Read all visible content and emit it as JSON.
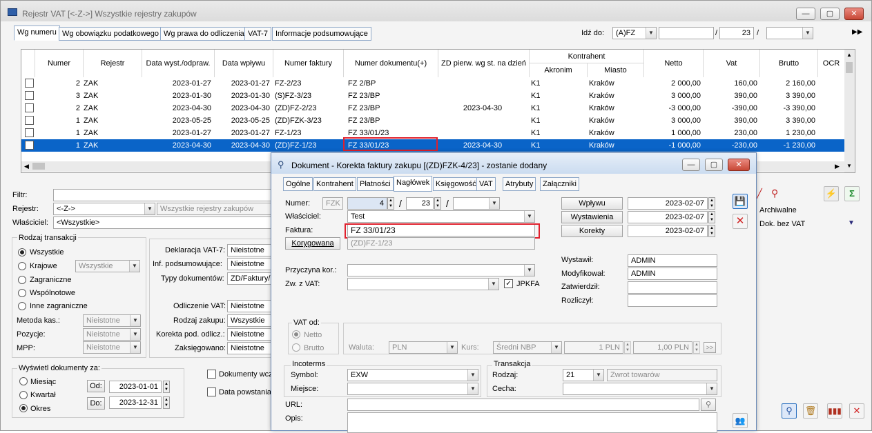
{
  "main_window": {
    "title": "Rejestr VAT   [<-Z->]   Wszystkie rejestry zakupów",
    "controls": {
      "minimize": "—",
      "maximize": "▢",
      "close": "✕"
    }
  },
  "tabs": [
    "Wg numeru",
    "Wg obowiązku podatkowego",
    "Wg prawa do odliczenia",
    "VAT-7",
    "Informacje podsumowujące"
  ],
  "goto": {
    "label": "Idź do:",
    "value": "(A)FZ",
    "number": "23",
    "sep": "/"
  },
  "table": {
    "headers": {
      "numer": "Numer",
      "rejestr": "Rejestr",
      "data_wyst": "Data wyst./odpraw.",
      "data_wplywu": "Data wpływu",
      "numer_faktury": "Numer faktury",
      "numer_dokumentu": "Numer dokumentu(+)",
      "zd": "ZD pierw. wg st. na dzień",
      "kontrahent": "Kontrahent",
      "akronim": "Akronim",
      "miasto": "Miasto",
      "netto": "Netto",
      "vat": "Vat",
      "brutto": "Brutto",
      "ocr": "OCR"
    },
    "rows": [
      {
        "numer": "2",
        "rejestr": "ZAK",
        "data_wyst": "2023-01-27",
        "data_wplywu": "2023-01-27",
        "numer_faktury": "FZ-2/23",
        "numer_dokumentu": "FZ 2/BP",
        "zd": "",
        "akronim": "K1",
        "miasto": "Kraków",
        "netto": "2 000,00",
        "vat": "160,00",
        "brutto": "2 160,00"
      },
      {
        "numer": "3",
        "rejestr": "ZAK",
        "data_wyst": "2023-01-30",
        "data_wplywu": "2023-01-30",
        "numer_faktury": "(S)FZ-3/23",
        "numer_dokumentu": "FZ 23/BP",
        "zd": "",
        "akronim": "K1",
        "miasto": "Kraków",
        "netto": "3 000,00",
        "vat": "390,00",
        "brutto": "3 390,00"
      },
      {
        "numer": "2",
        "rejestr": "ZAK",
        "data_wyst": "2023-04-30",
        "data_wplywu": "2023-04-30",
        "numer_faktury": "(ZD)FZ-2/23",
        "numer_dokumentu": "FZ 23/BP",
        "zd": "2023-04-30",
        "akronim": "K1",
        "miasto": "Kraków",
        "netto": "-3 000,00",
        "vat": "-390,00",
        "brutto": "-3 390,00"
      },
      {
        "numer": "1",
        "rejestr": "ZAK",
        "data_wyst": "2023-05-25",
        "data_wplywu": "2023-05-25",
        "numer_faktury": "(ZD)FZK-3/23",
        "numer_dokumentu": "FZ 23/BP",
        "zd": "",
        "akronim": "K1",
        "miasto": "Kraków",
        "netto": "3 000,00",
        "vat": "390,00",
        "brutto": "3 390,00"
      },
      {
        "numer": "1",
        "rejestr": "ZAK",
        "data_wyst": "2023-01-27",
        "data_wplywu": "2023-01-27",
        "numer_faktury": "FZ-1/23",
        "numer_dokumentu": "FZ 33/01/23",
        "zd": "",
        "akronim": "K1",
        "miasto": "Kraków",
        "netto": "1 000,00",
        "vat": "230,00",
        "brutto": "1 230,00"
      },
      {
        "numer": "1",
        "rejestr": "ZAK",
        "data_wyst": "2023-04-30",
        "data_wplywu": "2023-04-30",
        "numer_faktury": "(ZD)FZ-1/23",
        "numer_dokumentu": "FZ 33/01/23",
        "zd": "2023-04-30",
        "akronim": "K1",
        "miasto": "Kraków",
        "netto": "-1 000,00",
        "vat": "-230,00",
        "brutto": "-1 230,00"
      }
    ]
  },
  "filters": {
    "filtr_label": "Filtr:",
    "rejestr_label": "Rejestr:",
    "rejestr_value": "<-Z->",
    "rejestr_desc": "Wszystkie rejestry zakupów",
    "wlasciciel_label": "Właściciel:",
    "wlasciciel_value": "<Wszystkie>",
    "rodzaj_title": "Rodzaj transakcji",
    "rodzaj_options": [
      "Wszystkie",
      "Krajowe",
      "Zagraniczne",
      "Wspólnotowe",
      "Inne zagraniczne"
    ],
    "krajowe_value": "Wszystkie",
    "metoda_label": "Metoda kas.:",
    "pozycje_label": "Pozycje:",
    "mpp_label": "MPP:",
    "nieistotne": "Nieistotne",
    "deklaracja_label": "Deklaracja VAT-7:",
    "inf_label": "Inf. podsumowujące:",
    "typy_label": "Typy dokumentów:",
    "typy_value": "ZD/Faktury/",
    "odliczenie_label": "Odliczenie VAT:",
    "rodzaj_zakupu_label": "Rodzaj zakupu:",
    "rodzaj_zakupu_value": "Wszystkie",
    "korekta_label": "Korekta pod. odlicz.:",
    "zaksiegowano_label": "Zaksięgowano:",
    "wyswietl_title": "Wyświetl dokumenty za:",
    "periods": [
      "Miesiąc",
      "Kwartał",
      "Okres"
    ],
    "od_label": "Od:",
    "od_value": "2023-01-01",
    "do_label": "Do:",
    "do_value": "2023-12-31",
    "dokumenty_wcz": "Dokumenty wcz",
    "data_powstania": "Data powstania",
    "archiwalne": "Archiwalne",
    "dok_bez_vat": "Dok. bez VAT"
  },
  "dialog": {
    "title": "Dokument - Korekta faktury zakupu [(ZD)FZK-4/23]  - zostanie dodany",
    "tabs": [
      "Ogólne",
      "Kontrahent",
      "Płatności",
      "Nagłówek",
      "Księgowość",
      "VAT",
      "Atrybuty",
      "Załączniki"
    ],
    "numer_label": "Numer:",
    "numer_prefix": "FZK",
    "numer_value": "4",
    "numer_year": "23",
    "numer_sep": "/",
    "wlasciciel_label": "Właściciel:",
    "wlasciciel_value": "Test",
    "faktura_label": "Faktura:",
    "faktura_value": "FZ 33/01/23",
    "korygowana_button": "Korygowana",
    "korygowana_value": "(ZD)FZ-1/23",
    "przyczyna_label": "Przyczyna kor.:",
    "zw_label": "Zw. z VAT:",
    "jpkfa_label": "JPKFA",
    "wplywu_button": "Wpływu",
    "wplywu_value": "2023-02-07",
    "wystawienia_button": "Wystawienia",
    "wystawienia_value": "2023-02-07",
    "korekty_button": "Korekty",
    "korekty_value": "2023-02-07",
    "wystawil_label": "Wystawił:",
    "wystawil_value": "ADMIN",
    "modyfikowal_label": "Modyfikował:",
    "modyfikowal_value": "ADMIN",
    "zatwierdzil_label": "Zatwierdził:",
    "rozliczyl_label": "Rozliczył:",
    "vat_od_title": "VAT od:",
    "vat_netto": "Netto",
    "vat_brutto": "Brutto",
    "waluta_label": "Waluta:",
    "waluta_value": "PLN",
    "kurs_label": "Kurs:",
    "kurs_value": "Średni NBP",
    "kurs_pln1": "1 PLN",
    "kurs_pln2": "1,00 PLN",
    "kurs_more": ">>",
    "incoterms_title": "Incoterms",
    "symbol_label": "Symbol:",
    "symbol_value": "EXW",
    "miejsce_label": "Miejsce:",
    "transakcja_title": "Transakcja",
    "rodzaj_label": "Rodzaj:",
    "rodzaj_value": "21",
    "rodzaj_desc": "Zwrot towarów",
    "cecha_label": "Cecha:",
    "url_label": "URL:",
    "opis_label": "Opis:"
  }
}
